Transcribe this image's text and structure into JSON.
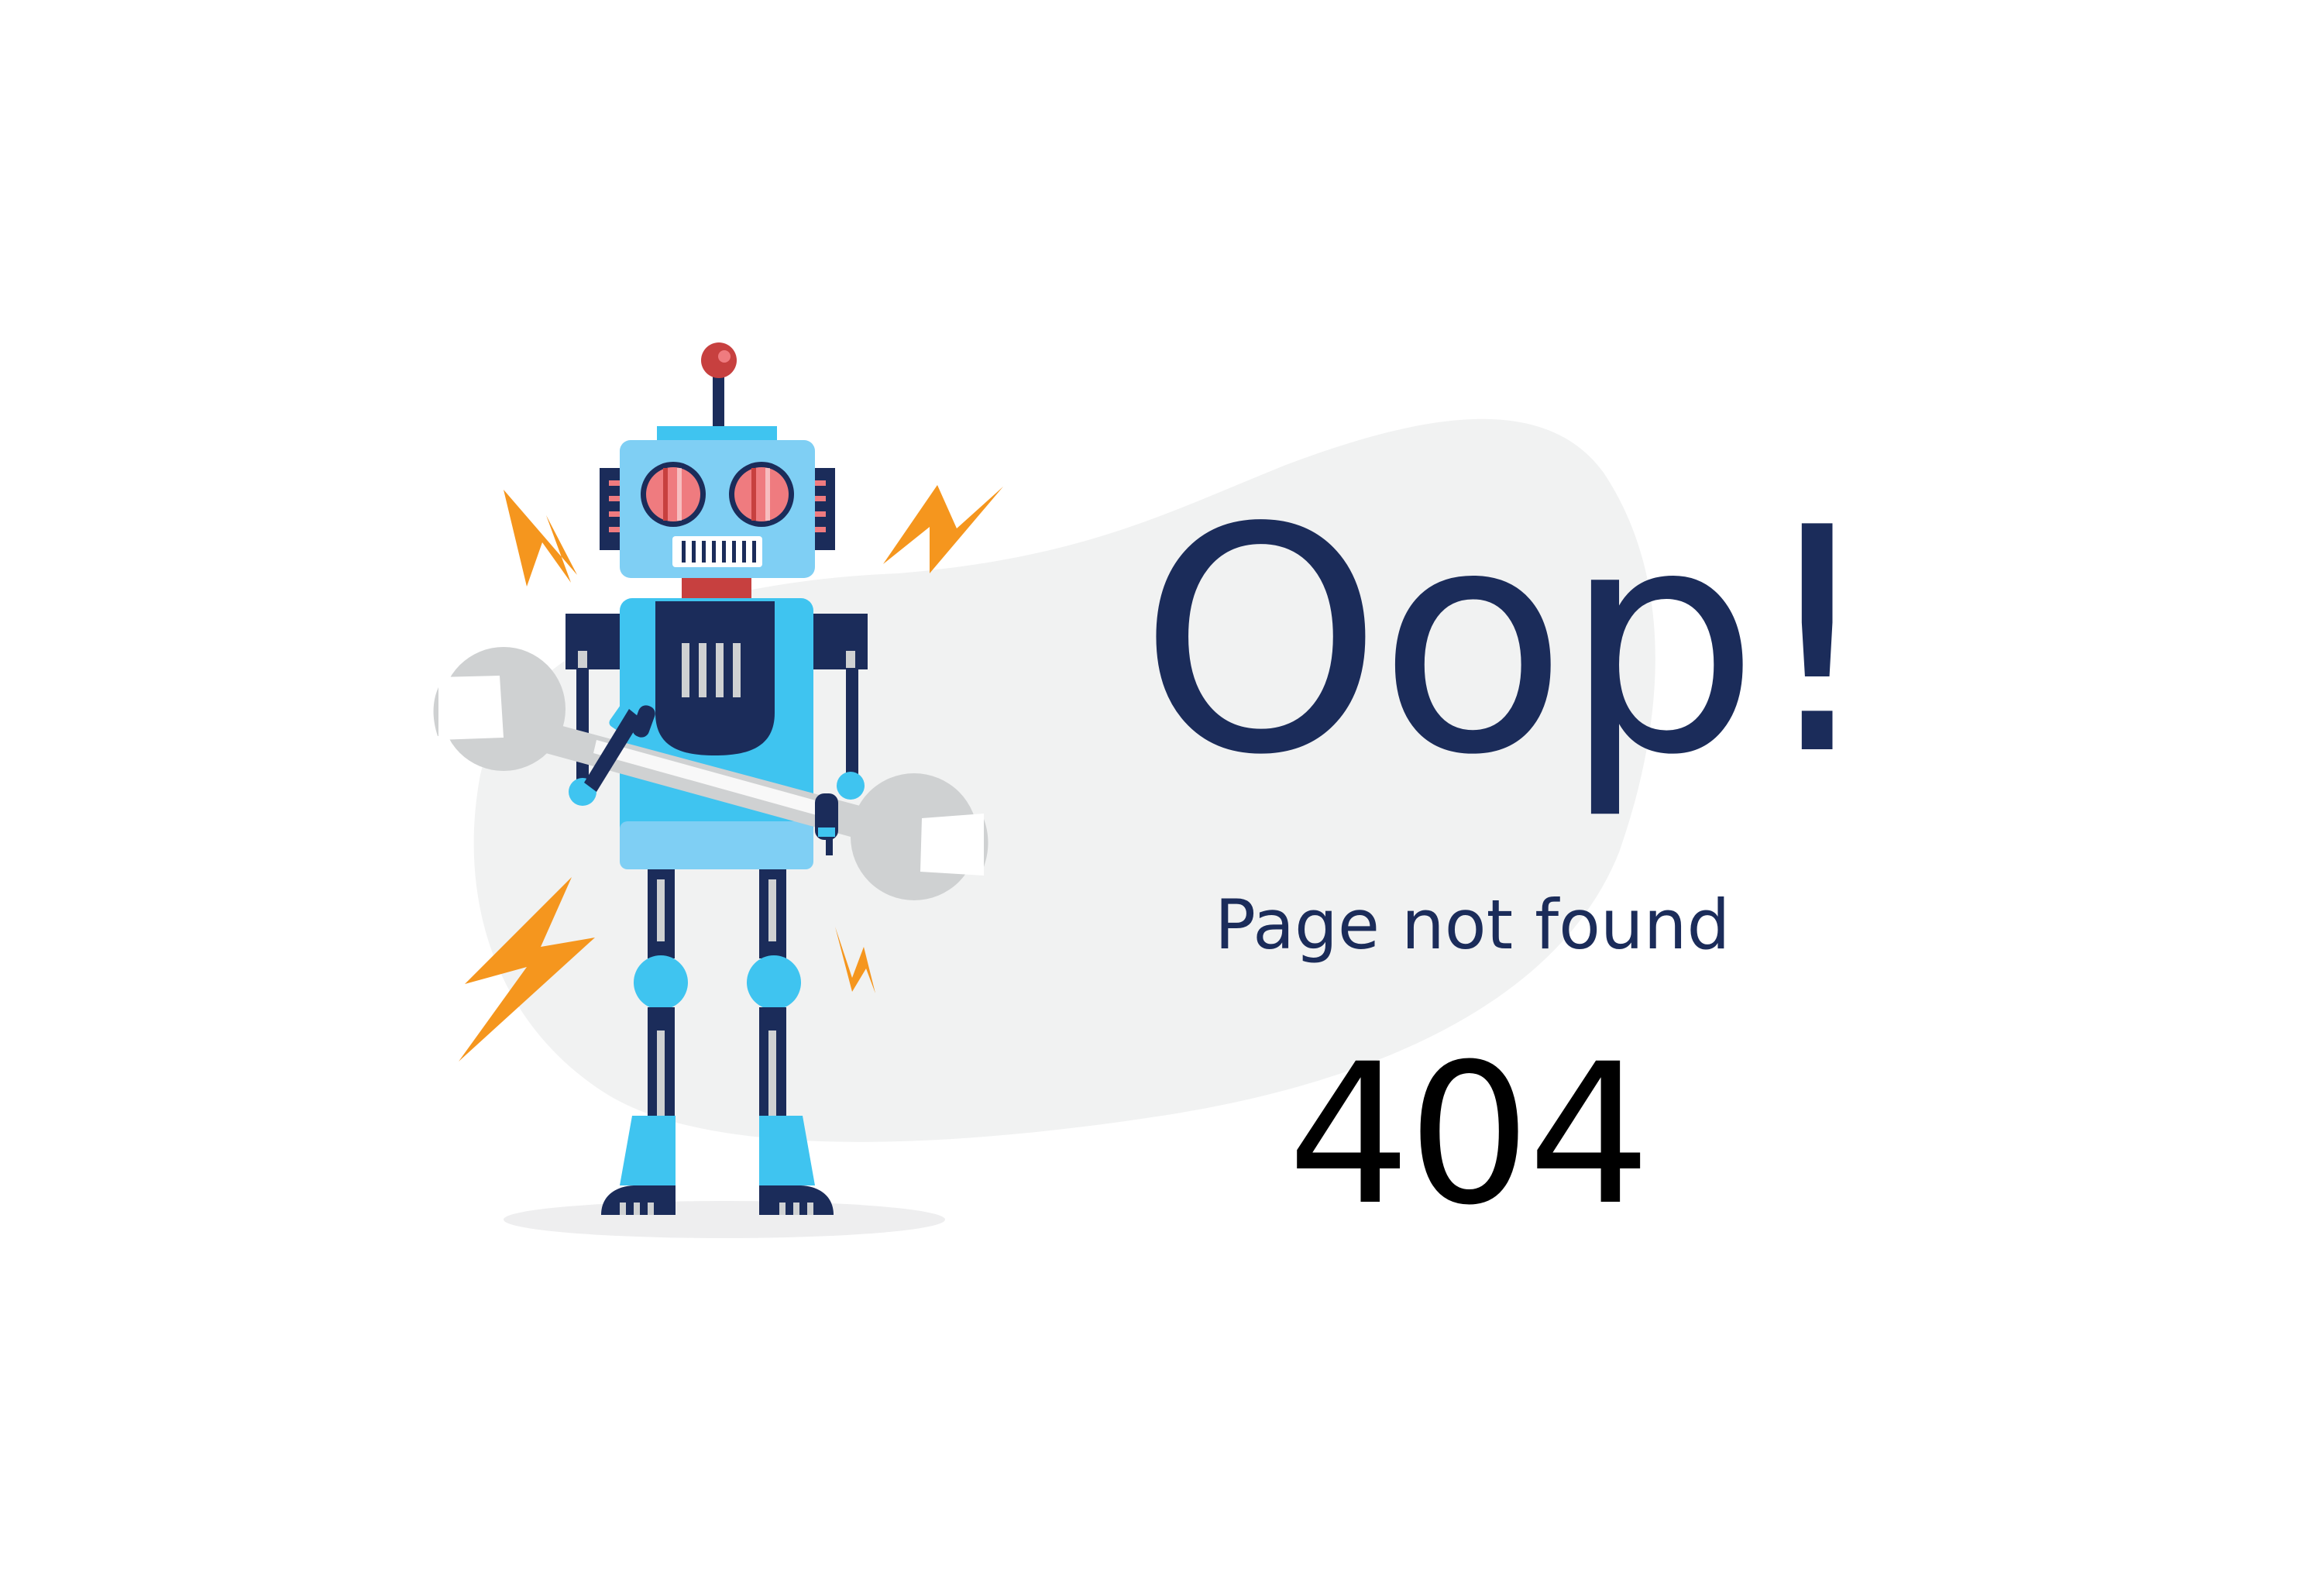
{
  "error_page": {
    "headline": "Oop!",
    "message": "Page not found",
    "code": "404"
  },
  "illustration": {
    "figure": "robot-holding-wrench",
    "effects": "lightning-bolt-icons"
  },
  "colors": {
    "text_dark": "#1b2c5a",
    "text_code": "#000000",
    "backdrop_blob": "#f1f2f2",
    "robot_light_blue": "#7fcff4",
    "robot_bright_blue": "#3fc4f0",
    "robot_navy": "#1b2c5a",
    "robot_red": "#c7403f",
    "eye_pink": "#ef7b7f",
    "wrench_gray": "#cfd1d2",
    "lightning_orange": "#f5961e"
  }
}
